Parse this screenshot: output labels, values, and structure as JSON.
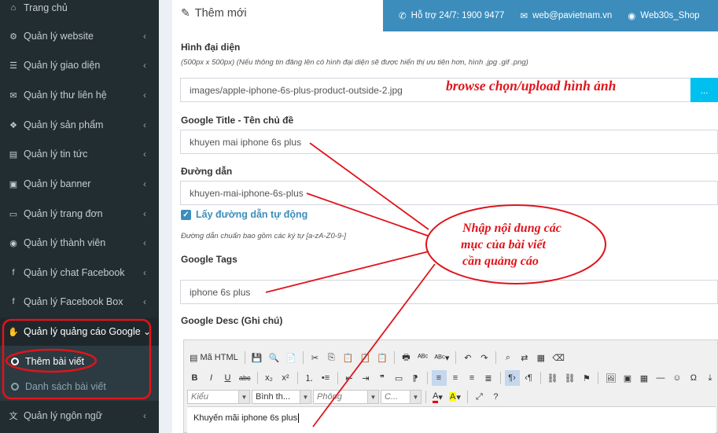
{
  "sidebar": {
    "items": [
      {
        "label": "Trang chủ",
        "icon": "home-icon",
        "glyph": "⌂",
        "chevron": ""
      },
      {
        "label": "Quản lý website",
        "icon": "cogs-icon",
        "glyph": "⚙",
        "chevron": "‹"
      },
      {
        "label": "Quản lý giao diện",
        "icon": "bars-icon",
        "glyph": "☰",
        "chevron": "‹"
      },
      {
        "label": "Quản lý thư liên hệ",
        "icon": "envelope-icon",
        "glyph": "✉",
        "chevron": "‹"
      },
      {
        "label": "Quản lý sản phẩm",
        "icon": "cubes-icon",
        "glyph": "❖",
        "chevron": "‹"
      },
      {
        "label": "Quản lý tin tức",
        "icon": "newspaper-icon",
        "glyph": "▤",
        "chevron": "‹"
      },
      {
        "label": "Quản lý banner",
        "icon": "image-icon",
        "glyph": "▣",
        "chevron": "‹"
      },
      {
        "label": "Quản lý trang đơn",
        "icon": "laptop-icon",
        "glyph": "▭",
        "chevron": "‹"
      },
      {
        "label": "Quản lý thành viên",
        "icon": "user-circle-icon",
        "glyph": "◉",
        "chevron": "‹"
      },
      {
        "label": "Quản lý chat Facebook",
        "icon": "facebook-icon",
        "glyph": "f",
        "chevron": "‹"
      },
      {
        "label": "Quản lý Facebook Box",
        "icon": "facebook-square-icon",
        "glyph": "f",
        "chevron": "‹"
      },
      {
        "label": "Quản lý quảng cáo Google",
        "icon": "hand-icon",
        "glyph": "✋",
        "chevron": "⌄"
      },
      {
        "label": "Quản lý ngôn ngữ",
        "icon": "language-icon",
        "glyph": "文",
        "chevron": "‹"
      }
    ],
    "sub_items": [
      {
        "label": "Thêm bài viết"
      },
      {
        "label": "Danh sách bài viết"
      }
    ]
  },
  "topbar": {
    "support": "Hỗ trợ 24/7: 1900 9477",
    "email": "web@pavietnam.vn",
    "account": "Web30s_Shop"
  },
  "form": {
    "heading": "Thêm mới",
    "avatar_label": "Hình đại diện",
    "avatar_hint": "(500px x 500px) (Nếu thông tin đăng lên có hình đại diện sẽ được hiển thị ưu tiên hơn, hình .jpg .gif .png)",
    "avatar_value": "images/apple-iphone-6s-plus-product-outside-2.jpg",
    "browse_label": "...",
    "title_label": "Google Title - Tên chủ đề",
    "title_value": "khuyen mai iphone 6s plus",
    "path_label": "Đường dẫn",
    "path_value": "khuyen-mai-iphone-6s-plus",
    "auto_path_label": "Lấy đường dẫn tự động",
    "path_hint": "Đường dẫn chuẩn bao gồm các ký tự [a-zA-Z0-9-]",
    "tags_label": "Google Tags",
    "tags_value": "iphone 6s plus",
    "desc_label": "Google Desc (Ghi chú)"
  },
  "editor": {
    "source_label": "Mã HTML",
    "format_combo": "Kiểu",
    "block_combo": "Bình th...",
    "font_combo": "Phông",
    "size_combo": "C...",
    "content": "Khuyến mãi iphone 6s plus"
  },
  "annotations": {
    "browse_note": "browse chọn/upload hình ảnh",
    "content_note_1": "Nhập nội dung các",
    "content_note_2": "mục của bài viết",
    "content_note_3": "cần quảng cáo"
  },
  "colors": {
    "sidebar_bg": "#222d32",
    "topbar_bg": "#3c8dbc",
    "annotation_red": "#e0141b"
  }
}
